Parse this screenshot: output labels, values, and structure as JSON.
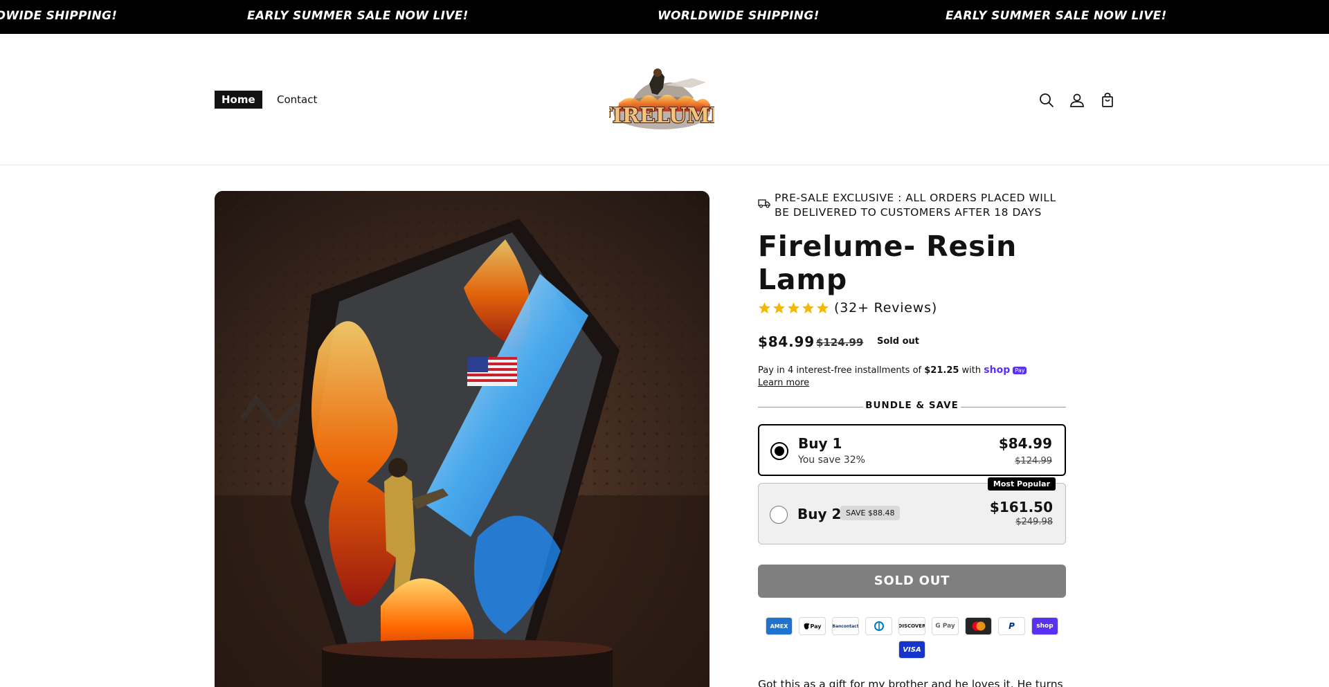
{
  "announcement": {
    "items": [
      "DWIDE SHIPPING!",
      "EARLY SUMMER SALE NOW LIVE!",
      "WORLDWIDE SHIPPING!",
      "EARLY SUMMER SALE NOW LIVE!"
    ]
  },
  "header": {
    "nav": {
      "home": "Home",
      "contact": "Contact"
    },
    "logo_text": "FIRELUME",
    "icons": [
      "search-icon",
      "account-icon",
      "cart-icon"
    ]
  },
  "product": {
    "presale_notice": "PRE-SALE EXCLUSIVE : ALL ORDERS PLACED WILL BE DELIVERED TO CUSTOMERS AFTER 18 DAYS",
    "title": "Firelume- Resin Lamp",
    "rating_stars": 5,
    "reviews": "(32+ Reviews)",
    "price": "$84.99",
    "compare_price": "$124.99",
    "sold_badge": "Sold out",
    "installments_prefix": "Pay in 4 interest-free installments of ",
    "installment_amount": "$21.25",
    "installments_with": " with ",
    "shop_pay": "shop",
    "shop_pay_badge": "Pay",
    "learn_more": "Learn more",
    "bundle_title": "BUNDLE & SAVE",
    "bundles": [
      {
        "label": "Buy 1",
        "subtitle": "You save 32%",
        "price": "$84.99",
        "compare": "$124.99",
        "selected": true
      },
      {
        "label": "Buy 2",
        "save_badge": "SAVE $88.48",
        "price": "$161.50",
        "compare": "$249.98",
        "tag": "Most Popular",
        "selected": false
      }
    ],
    "button": "SOLD OUT",
    "payment_methods": [
      "AMEX",
      "Pay",
      "Bancontact",
      "Diners",
      "DISCOVER",
      "G Pay",
      "Mastercard",
      "P",
      "shop",
      "VISA"
    ],
    "review_snippet": "Got this as a gift for my brother and he loves it. He turns"
  },
  "colors": {
    "announcement_bg": "#000000",
    "star": "#f5b800",
    "shop_pay": "#5a31f4",
    "soldout_button": "#7f7f7f"
  }
}
